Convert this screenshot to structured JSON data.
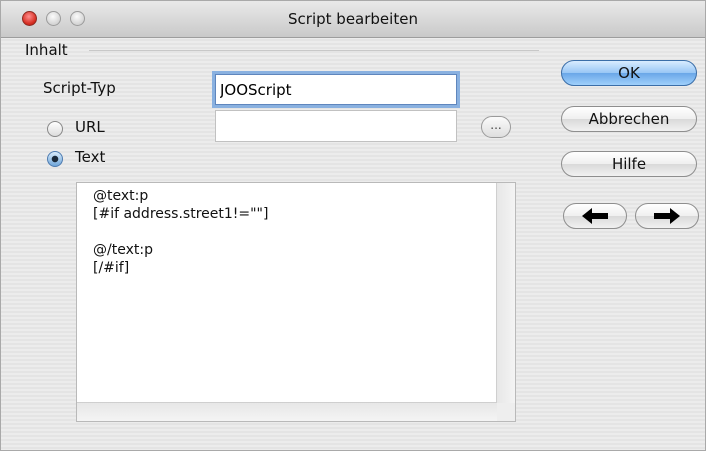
{
  "window": {
    "title": "Script bearbeiten"
  },
  "form": {
    "section_label": "Inhalt",
    "script_type_label": "Script-Typ",
    "script_type_value": "JOOScript",
    "url_label": "URL",
    "url_value": "",
    "url_browse_label": "...",
    "text_label": "Text",
    "selected_source": "Text",
    "script_text": "@text:p\n[#if address.street1!=\"\"]\n\n@/text:p\n[/#if]"
  },
  "buttons": {
    "ok": "OK",
    "cancel": "Abbrechen",
    "help": "Hilfe"
  },
  "icons": {
    "back": "left-arrow-icon",
    "forward": "right-arrow-icon"
  },
  "colors": {
    "default_button": "#7ab6f0",
    "focus_ring": "#8ab1e0",
    "close_button": "#d62e22"
  }
}
